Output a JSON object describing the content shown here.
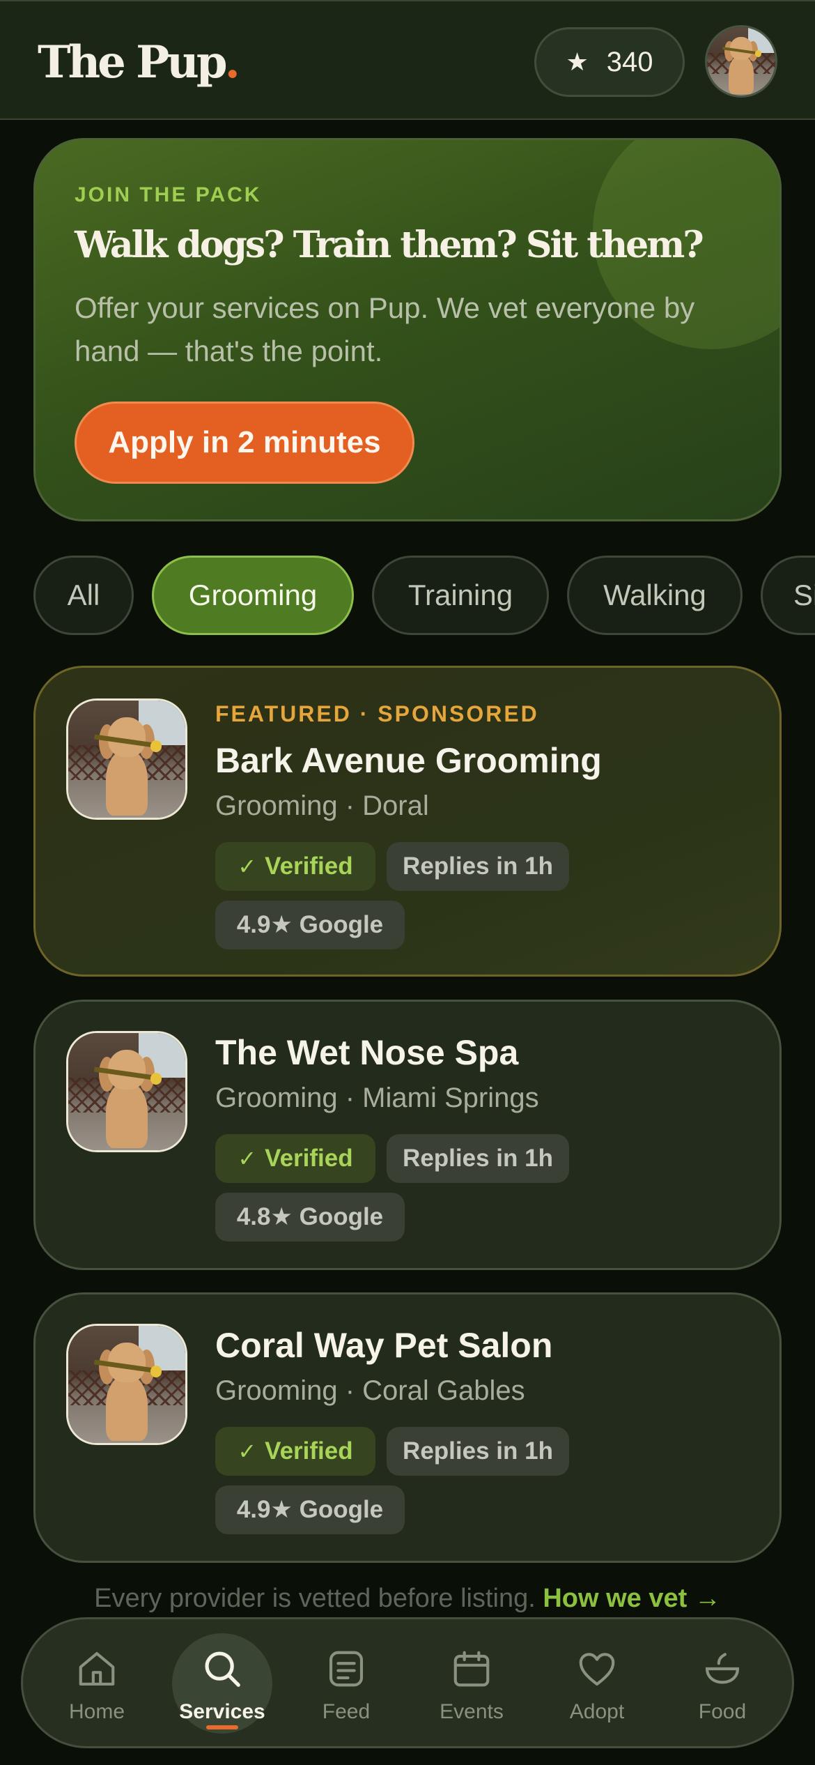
{
  "header": {
    "logo_text": "The Pup",
    "logo_dot": ".",
    "points_icon": "star-icon",
    "points_value": "340"
  },
  "promo": {
    "kicker": "JOIN THE PACK",
    "title": "Walk dogs? Train them? Sit them?",
    "text": "Offer your services on Pup. We vet everyone by hand — that's the point.",
    "button_label": "Apply in 2 minutes"
  },
  "filters": {
    "chips": [
      "All",
      "Grooming",
      "Training",
      "Walking",
      "Si"
    ],
    "selected": "Grooming"
  },
  "providers": [
    {
      "kicker": "FEATURED · SPONSORED",
      "name": "Bark Avenue Grooming",
      "subtitle": "Grooming · Doral",
      "verified": "Verified",
      "response": "Replies in 1h",
      "rating": "4.9★ Google"
    },
    {
      "name": "The Wet Nose Spa",
      "subtitle": "Grooming · Miami Springs",
      "verified": "Verified",
      "response": "Replies in 1h",
      "rating": "4.8★ Google"
    },
    {
      "name": "Coral Way Pet Salon",
      "subtitle": "Grooming · Coral Gables",
      "verified": "Verified",
      "response": "Replies in 1h",
      "rating": "4.9★ Google"
    }
  ],
  "footer_note": {
    "text": "Every provider is vetted before listing.",
    "link": "How we vet →"
  },
  "nav": {
    "items": [
      {
        "label": "Home",
        "icon": "home-icon"
      },
      {
        "label": "Services",
        "icon": "search-icon"
      },
      {
        "label": "Feed",
        "icon": "feed-icon"
      },
      {
        "label": "Events",
        "icon": "calendar-icon"
      },
      {
        "label": "Adopt",
        "icon": "heart-icon"
      },
      {
        "label": "Food",
        "icon": "bowl-icon"
      }
    ],
    "active": "Services"
  },
  "colors": {
    "accent_orange": "#e35f22",
    "accent_green": "#8cc13f",
    "featured_gold": "#e6a63c"
  }
}
